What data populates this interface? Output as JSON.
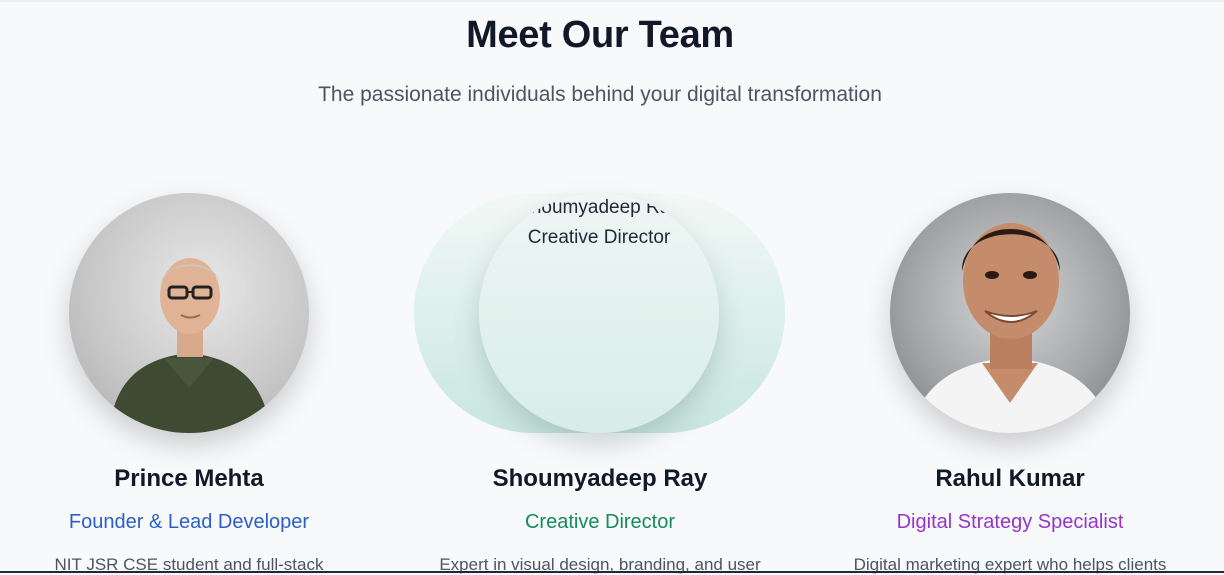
{
  "header": {
    "title": "Meet Our Team",
    "subtitle": "The passionate individuals behind your digital transformation"
  },
  "team": [
    {
      "name": "Prince Mehta",
      "role": "Founder & Lead Developer",
      "description": "NIT JSR CSE student and full-stack",
      "role_color": "#2b5fc7"
    },
    {
      "name": "Shoumyadeep Ray",
      "role": "Creative Director",
      "description": "Expert in visual design, branding, and user",
      "role_color": "#168a5a",
      "image_alt_name": "Shoumyadeep Ray",
      "image_alt_role": "Creative Director"
    },
    {
      "name": "Rahul Kumar",
      "role": "Digital Strategy Specialist",
      "description": "Digital marketing expert who helps clients",
      "role_color": "#9535c9"
    }
  ]
}
